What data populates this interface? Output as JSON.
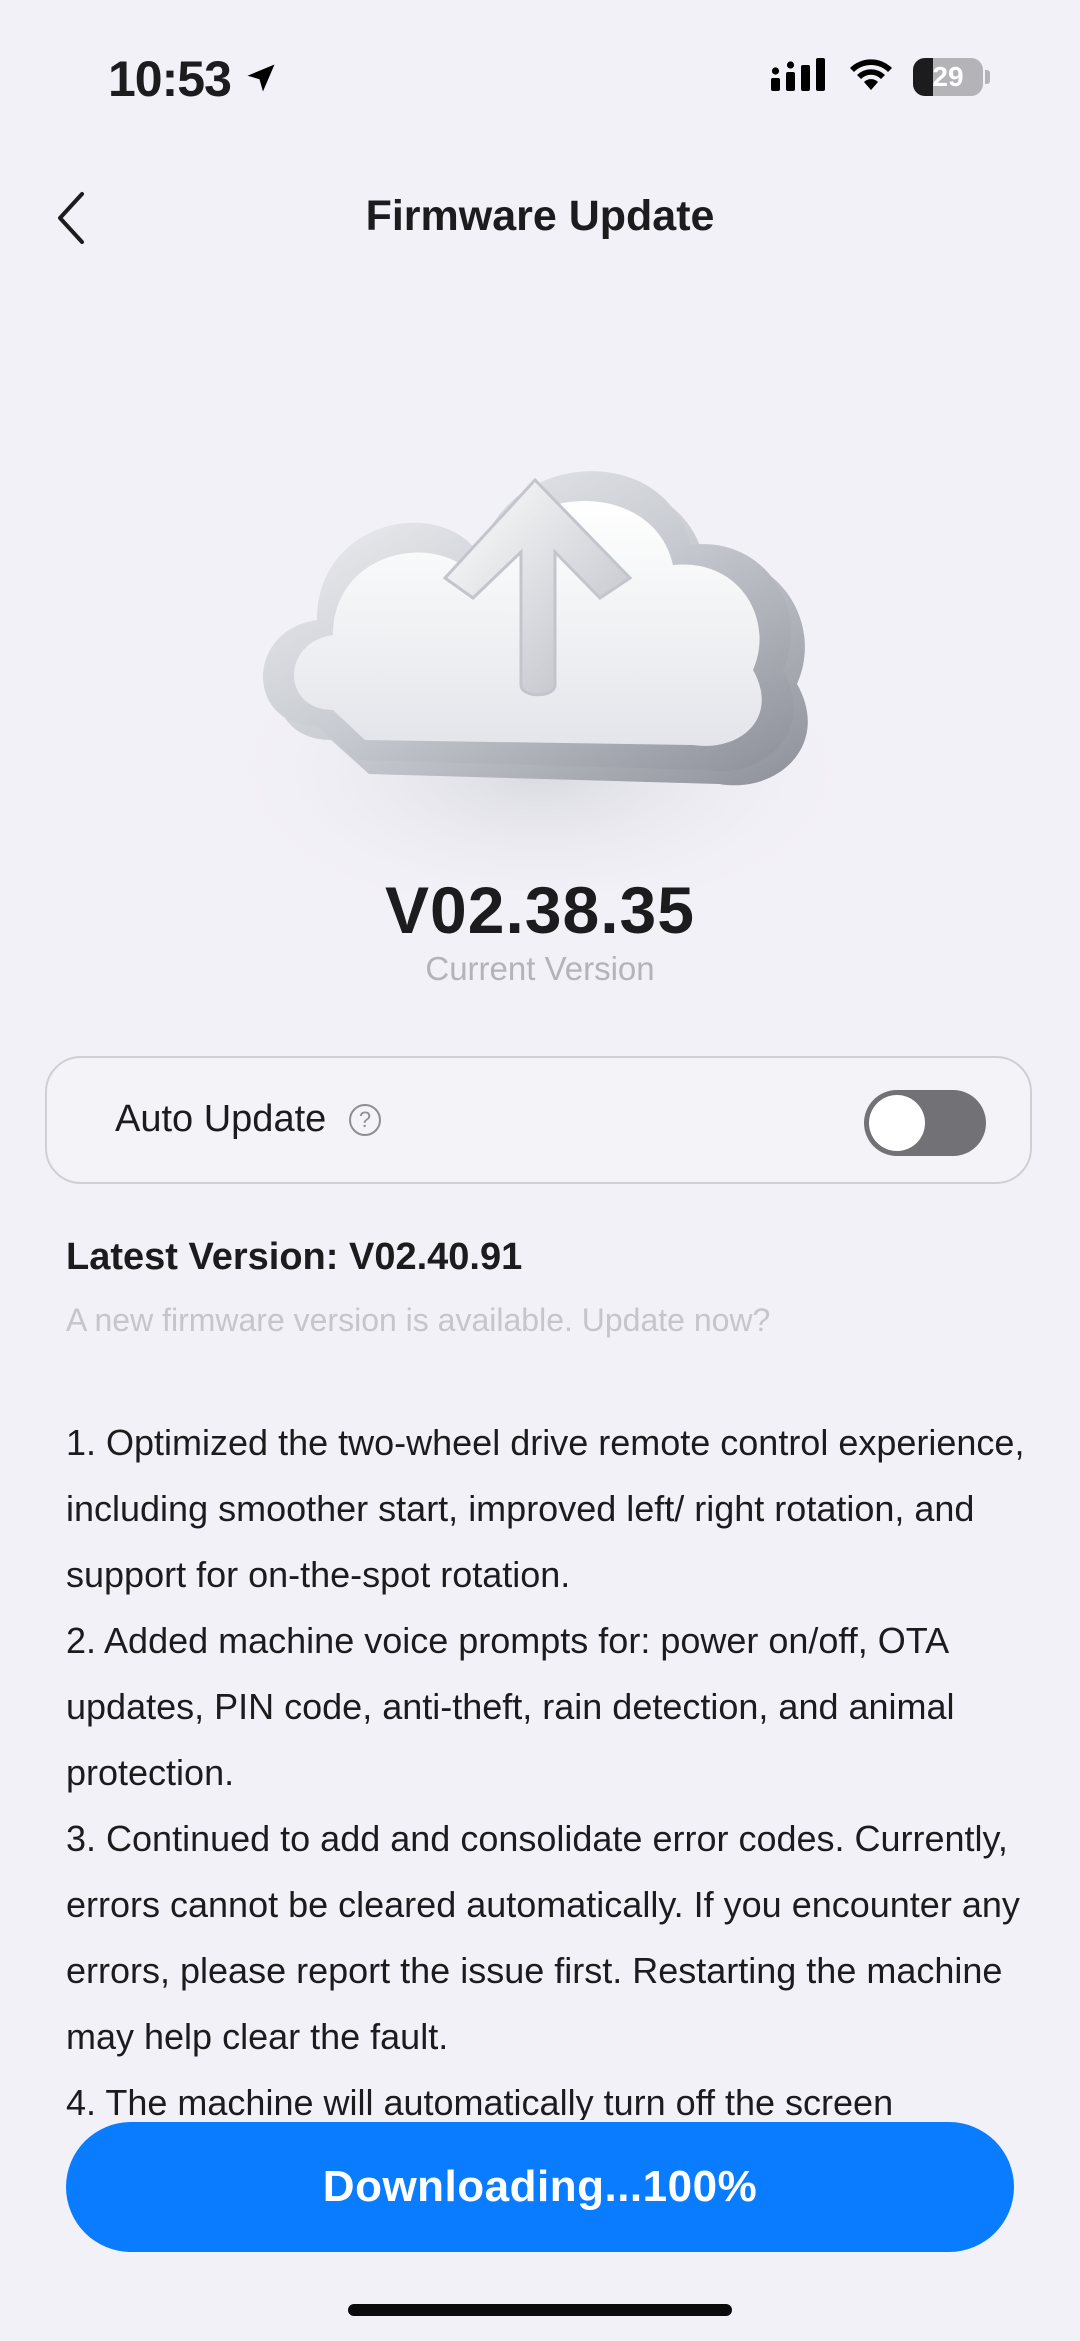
{
  "status_bar": {
    "time": "10:53",
    "battery_level": "29",
    "icons": [
      "location-arrow-icon",
      "cellular-signal-icon",
      "wifi-icon",
      "battery-icon"
    ]
  },
  "header": {
    "title": "Firmware Update",
    "back_icon": "chevron-left-icon"
  },
  "hero": {
    "icon": "cloud-upload-icon"
  },
  "current_version": {
    "value": "V02.38.35",
    "caption": "Current Version"
  },
  "auto_update": {
    "label": "Auto Update",
    "help_glyph": "?",
    "enabled": false
  },
  "latest": {
    "title": "Latest Version: V02.40.91",
    "prompt": "A new firmware version is available. Update now?"
  },
  "release_notes": [
    "1. Optimized the two-wheel drive remote control experience, including smoother start, improved left/ right rotation, and support for on-the-spot rotation.",
    "2. Added machine voice prompts for: power on/off, OTA updates, PIN code, anti-theft, rain detection, and animal protection.",
    "3. Continued to add and consolidate error codes. Currently, errors cannot be cleared automatically. If you encounter any errors, please report the issue first. Restarting the machine may help clear the fault.",
    "4. The machine will automatically turn off the screen"
  ],
  "download": {
    "label": "Downloading...100%",
    "progress": 1.0
  },
  "colors": {
    "background": "#f2f1f7",
    "accent": "#0a7cff",
    "toggle_off": "#727276",
    "muted_text": "#b3b3b8"
  }
}
